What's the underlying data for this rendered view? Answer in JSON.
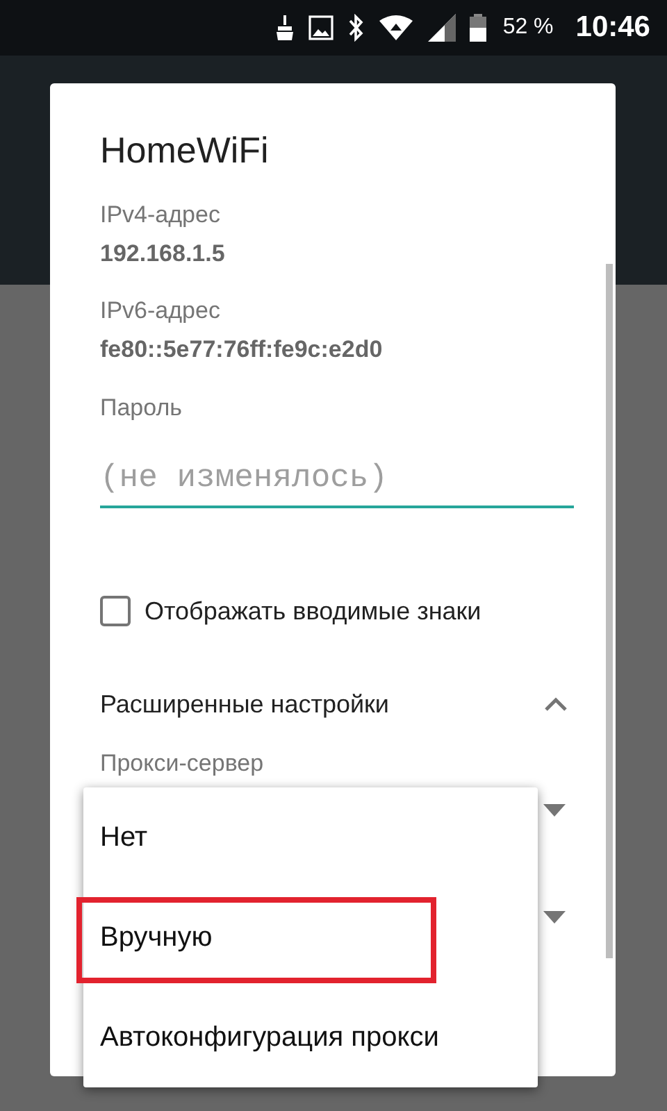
{
  "status_bar": {
    "battery_text": "52 %",
    "time": "10:46"
  },
  "dialog": {
    "title": "HomeWiFi",
    "fields": [
      {
        "label": "IPv4-адрес",
        "value": "192.168.1.5"
      },
      {
        "label": "IPv6-адрес",
        "value": "fe80::5e77:76ff:fe9c:e2d0"
      }
    ],
    "password": {
      "label": "Пароль",
      "placeholder": "(не изменялось)"
    },
    "show_password": {
      "label": "Отображать вводимые знаки",
      "checked": false
    },
    "advanced": {
      "label": "Расширенные настройки",
      "expanded": true
    },
    "proxy": {
      "label": "Прокси-сервер"
    }
  },
  "proxy_menu": {
    "options": [
      {
        "label": "Нет",
        "highlighted": false
      },
      {
        "label": "Вручную",
        "highlighted": true
      },
      {
        "label": "Автоконфигурация прокси",
        "highlighted": false
      }
    ]
  }
}
